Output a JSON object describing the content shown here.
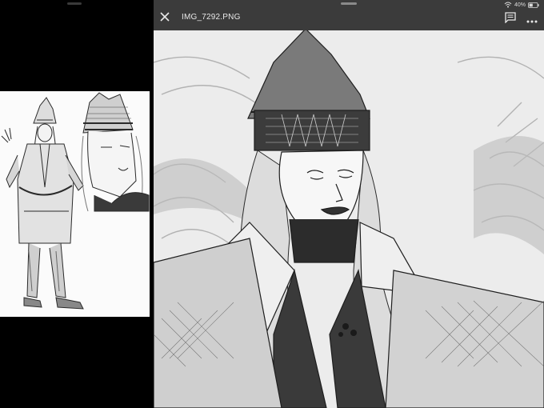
{
  "viewer": {
    "file_name": "IMG_7292.PNG"
  },
  "status_bar": {
    "battery_percent": "40%"
  },
  "icons": {
    "close": "close-icon",
    "comments": "comment-icon",
    "more": "more-icon",
    "wifi": "wifi-icon",
    "battery": "battery-icon"
  },
  "colors": {
    "toolbar": "#3b3b3b",
    "background": "#000000",
    "sketch_paper": "#fbfbfb"
  }
}
